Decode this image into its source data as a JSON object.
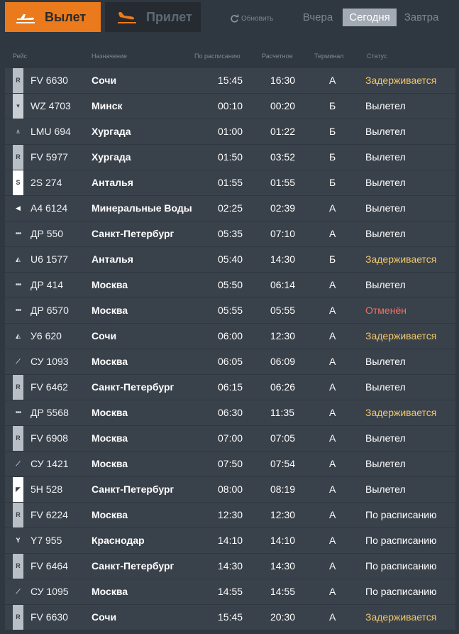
{
  "tabs": {
    "departure_label": "Вылет",
    "arrival_label": "Прилет"
  },
  "refresh_label": "Обновить",
  "days": {
    "yesterday": "Вчера",
    "today": "Сегодня",
    "tomorrow": "Завтра"
  },
  "columns": {
    "flight": "Рейс",
    "destination": "Назначение",
    "scheduled": "По расписанию",
    "estimated": "Расчетное",
    "terminal": "Терминал",
    "status": "Статус"
  },
  "colors": {
    "accent": "#ea7a1c",
    "delayed": "#f3c86b",
    "cancelled": "#f07065",
    "normal": "#ffffff"
  },
  "flights": [
    {
      "airline_icon": "r-logo-icon",
      "flight": "FV 6630",
      "destination": "Сочи",
      "scheduled": "15:45",
      "estimated": "16:30",
      "terminal": "A",
      "status": "Задерживается",
      "status_type": "delayed"
    },
    {
      "airline_icon": "wizz-logo-icon",
      "flight": "WZ 4703",
      "destination": "Минск",
      "scheduled": "00:10",
      "estimated": "00:20",
      "terminal": "Б",
      "status": "Вылетел",
      "status_type": "normal"
    },
    {
      "airline_icon": "lmu-logo-icon",
      "flight": "LMU 694",
      "destination": "Хургада",
      "scheduled": "01:00",
      "estimated": "01:22",
      "terminal": "Б",
      "status": "Вылетел",
      "status_type": "normal"
    },
    {
      "airline_icon": "r-logo-icon",
      "flight": "FV 5977",
      "destination": "Хургада",
      "scheduled": "01:50",
      "estimated": "03:52",
      "terminal": "Б",
      "status": "Вылетел",
      "status_type": "normal"
    },
    {
      "airline_icon": "s7-logo-icon",
      "flight": "2S 274",
      "destination": "Анталья",
      "scheduled": "01:55",
      "estimated": "01:55",
      "terminal": "Б",
      "status": "Вылетел",
      "status_type": "normal"
    },
    {
      "airline_icon": "a4-logo-icon",
      "flight": "A4 6124",
      "destination": "Минеральные Воды",
      "scheduled": "02:25",
      "estimated": "02:39",
      "terminal": "A",
      "status": "Вылетел",
      "status_type": "normal"
    },
    {
      "airline_icon": "dots-logo-icon",
      "flight": "ДР 550",
      "destination": "Санкт-Петербург",
      "scheduled": "05:35",
      "estimated": "07:10",
      "terminal": "A",
      "status": "Вылетел",
      "status_type": "normal"
    },
    {
      "airline_icon": "u6-logo-icon",
      "flight": "U6 1577",
      "destination": "Анталья",
      "scheduled": "05:40",
      "estimated": "14:30",
      "terminal": "Б",
      "status": "Задерживается",
      "status_type": "delayed"
    },
    {
      "airline_icon": "dots-logo-icon",
      "flight": "ДР 414",
      "destination": "Москва",
      "scheduled": "05:50",
      "estimated": "06:14",
      "terminal": "A",
      "status": "Вылетел",
      "status_type": "normal"
    },
    {
      "airline_icon": "dots-logo-icon",
      "flight": "ДР 6570",
      "destination": "Москва",
      "scheduled": "05:55",
      "estimated": "05:55",
      "terminal": "A",
      "status": "Отменён",
      "status_type": "cancelled"
    },
    {
      "airline_icon": "u6-logo-icon",
      "flight": "У6 620",
      "destination": "Сочи",
      "scheduled": "06:00",
      "estimated": "12:30",
      "terminal": "A",
      "status": "Задерживается",
      "status_type": "delayed"
    },
    {
      "airline_icon": "su-logo-icon",
      "flight": "СУ 1093",
      "destination": "Москва",
      "scheduled": "06:05",
      "estimated": "06:09",
      "terminal": "A",
      "status": "Вылетел",
      "status_type": "normal"
    },
    {
      "airline_icon": "r-logo-icon",
      "flight": "FV 6462",
      "destination": "Санкт-Петербург",
      "scheduled": "06:15",
      "estimated": "06:26",
      "terminal": "A",
      "status": "Вылетел",
      "status_type": "normal"
    },
    {
      "airline_icon": "dots-logo-icon",
      "flight": "ДР 5568",
      "destination": "Москва",
      "scheduled": "06:30",
      "estimated": "11:35",
      "terminal": "A",
      "status": "Задерживается",
      "status_type": "delayed"
    },
    {
      "airline_icon": "r-logo-icon",
      "flight": "FV 6908",
      "destination": "Москва",
      "scheduled": "07:00",
      "estimated": "07:05",
      "terminal": "A",
      "status": "Вылетел",
      "status_type": "normal"
    },
    {
      "airline_icon": "su-logo-icon",
      "flight": "СУ 1421",
      "destination": "Москва",
      "scheduled": "07:50",
      "estimated": "07:54",
      "terminal": "A",
      "status": "Вылетел",
      "status_type": "normal"
    },
    {
      "airline_icon": "5h-logo-icon",
      "flight": "5H 528",
      "destination": "Санкт-Петербург",
      "scheduled": "08:00",
      "estimated": "08:19",
      "terminal": "A",
      "status": "Вылетел",
      "status_type": "normal"
    },
    {
      "airline_icon": "r-logo-icon",
      "flight": "FV 6224",
      "destination": "Москва",
      "scheduled": "12:30",
      "estimated": "12:30",
      "terminal": "A",
      "status": "По расписанию",
      "status_type": "normal"
    },
    {
      "airline_icon": "y7-logo-icon",
      "flight": "Y7 955",
      "destination": "Краснодар",
      "scheduled": "14:10",
      "estimated": "14:10",
      "terminal": "A",
      "status": "По расписанию",
      "status_type": "normal"
    },
    {
      "airline_icon": "r-logo-icon",
      "flight": "FV 6464",
      "destination": "Санкт-Петербург",
      "scheduled": "14:30",
      "estimated": "14:30",
      "terminal": "A",
      "status": "По расписанию",
      "status_type": "normal"
    },
    {
      "airline_icon": "su-logo-icon",
      "flight": "СУ 1095",
      "destination": "Москва",
      "scheduled": "14:55",
      "estimated": "14:55",
      "terminal": "A",
      "status": "По расписанию",
      "status_type": "normal"
    },
    {
      "airline_icon": "r-logo-icon",
      "flight": "FV 6630",
      "destination": "Сочи",
      "scheduled": "15:45",
      "estimated": "20:30",
      "terminal": "A",
      "status": "Задерживается",
      "status_type": "delayed"
    }
  ]
}
